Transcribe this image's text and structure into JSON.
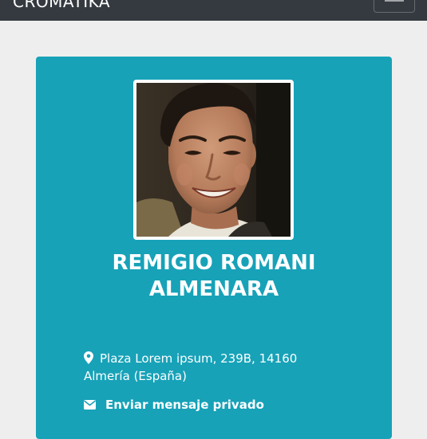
{
  "navbar": {
    "brand": "CROMATIKA",
    "toggle_icon": "hamburger-menu-icon"
  },
  "profile": {
    "name_line1": "REMIGIO ROMANI",
    "name_line2": "ALMENARA",
    "address_line1": "Plaza Lorem ipsum, 239B, 14160",
    "address_line2": "Almería (España)",
    "address_icon": "map-marker-icon",
    "message_label": "Enviar mensaje privado",
    "message_icon": "envelope-icon"
  },
  "colors": {
    "navbar_bg": "#343a40",
    "page_bg": "#eeeeee",
    "card_bg": "#17a2b8",
    "text": "#ffffff"
  }
}
